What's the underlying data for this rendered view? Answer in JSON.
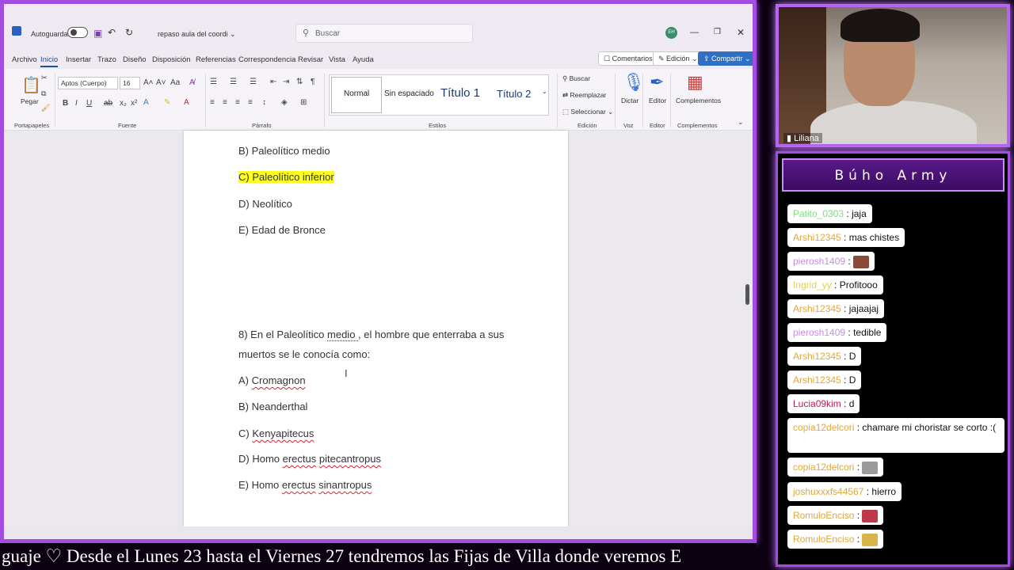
{
  "word": {
    "autosave_label": "Autoguardado",
    "doc_title": "repaso aula del coordi ⌄",
    "search_placeholder": "Buscar",
    "avatar_initials": "EH",
    "menu": [
      "Archivo",
      "Inicio",
      "Insertar",
      "Trazo",
      "Diseño",
      "Disposición",
      "Referencias",
      "Correspondencia",
      "Revisar",
      "Vista",
      "Ayuda"
    ],
    "comments_label": "Comentarios",
    "editing_label": "Edición ⌄",
    "share_label": "Compartir ⌄",
    "ribbon": {
      "paste_label": "Pegar",
      "clipboard_group": "Portapapeles",
      "font_name": "Aptos (Cuerpo)",
      "font_size": "16",
      "font_group": "Fuente",
      "paragraph_group": "Párrafo",
      "styles_group": "Estilos",
      "style_normal": "Normal",
      "style_nospacing": "Sin espaciado",
      "style_title1": "Título 1",
      "style_title2": "Título 2",
      "find_label": "Buscar",
      "replace_label": "Reemplazar",
      "select_label": "Seleccionar ⌄",
      "editing_group": "Edición",
      "dictate_label": "Dictar",
      "voice_group": "Voz",
      "editor_label": "Editor",
      "editor_group": "Editor",
      "addins_label": "Complementos",
      "addins_group": "Complementos"
    },
    "doc": {
      "lines": {
        "b1": "B) Paleolítico medio",
        "c1": "C) Paleolítico inferior",
        "d1": "D) Neolítico",
        "e1": "E) Edad de Bronce",
        "q8_a": "8) En el Paleolítico ",
        "q8_b": "medio ",
        "q8_c": ", el hombre que enterraba a sus",
        "q8_line2": "muertos se le conocía como:",
        "a2_pre": "A) ",
        "a2_word": "Cromagnon",
        "b2": "B) Neanderthal",
        "c2_pre": "C) ",
        "c2_word": "Kenyapitecus",
        "d2_pre": "D) Homo ",
        "d2_w1": "erectus",
        "d2_w2": "pitecantropus",
        "e2_pre": "E) Homo ",
        "e2_w1": "erectus",
        "e2_w2": "sinantropus"
      }
    }
  },
  "ticker_text": "guaje    ♡    Desde el Lunes 23 hasta el Viernes 27 tendremos las Fijas de Villa donde veremos E",
  "webcam": {
    "name": "Liliana"
  },
  "chat": {
    "title": "Búho Army",
    "messages": [
      {
        "user": "Patito_0303",
        "text": "jaja",
        "color": "#7ee07a"
      },
      {
        "user": "Arshi12345",
        "text": "mas chistes",
        "color": "#e0a63a"
      },
      {
        "user": "pierosh1409",
        "text": "",
        "color": "#c78be8",
        "emote": "#8a4a3a"
      },
      {
        "user": "Ingrid_yy",
        "text": "Profitooo",
        "color": "#e2d24a"
      },
      {
        "user": "Arshi12345",
        "text": "jajaajaj",
        "color": "#e0a63a"
      },
      {
        "user": "pierosh1409",
        "text": "tedible",
        "color": "#c78be8"
      },
      {
        "user": "Arshi12345",
        "text": "D",
        "color": "#e0a63a"
      },
      {
        "user": "Arshi12345",
        "text": "D",
        "color": "#e0a63a"
      },
      {
        "user": "Lucia09kim",
        "text": "d",
        "color": "#c2185b"
      },
      {
        "user": "copia12delcori",
        "text": "chamare mi choristar se corto :(",
        "color": "#e0a63a"
      },
      {
        "user": "copia12delcori",
        "text": "",
        "color": "#e0a63a",
        "emote": "#9a9a9a"
      },
      {
        "user": "joshuxxxfs44567",
        "text": "hierro",
        "color": "#e0a63a"
      },
      {
        "user": "RomuloEnciso",
        "text": "",
        "color": "#e0a63a",
        "emote": "#c0394b"
      },
      {
        "user": "RomuloEnciso",
        "text": "",
        "color": "#e0a63a",
        "emote": "#d9b44a"
      }
    ]
  }
}
